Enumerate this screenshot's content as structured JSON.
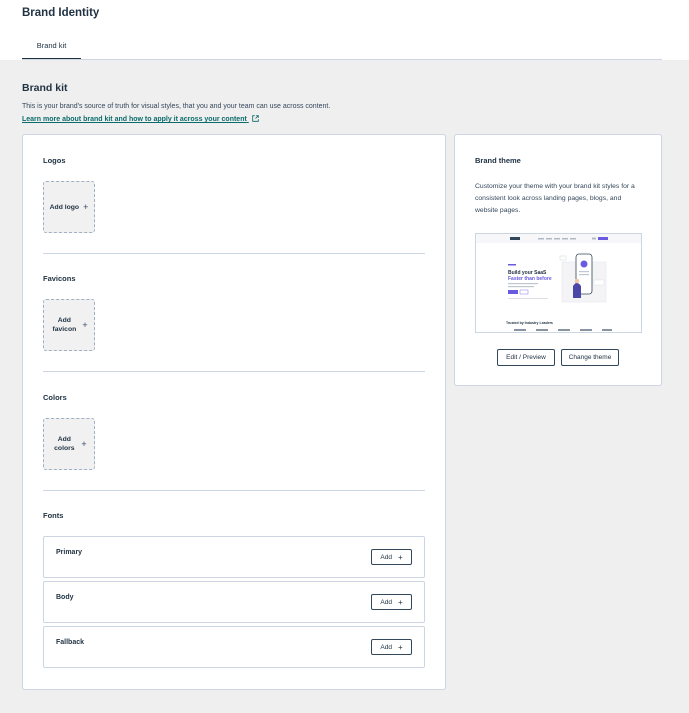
{
  "app": {
    "title": "Brand Identity"
  },
  "tabs": [
    {
      "label": "Brand kit",
      "active": true
    }
  ],
  "page": {
    "heading": "Brand kit",
    "description": "This is your brand's source of truth for visual styles, that you and your team can use across content.",
    "learn_link": "Learn more about brand kit and how to apply it across your content"
  },
  "logos": {
    "title": "Logos",
    "add_label": "Add logo"
  },
  "favicons": {
    "title": "Favicons",
    "add_label": "Add favicon"
  },
  "colors": {
    "title": "Colors",
    "add_label": "Add colors"
  },
  "fonts": {
    "title": "Fonts",
    "add_label": "Add",
    "items": [
      {
        "name": "Primary"
      },
      {
        "name": "Body"
      },
      {
        "name": "Fallback"
      }
    ]
  },
  "theme": {
    "title": "Brand theme",
    "description": "Customize your theme with your brand kit styles for a consistent look across landing pages, blogs, and website pages.",
    "preview": {
      "headline_line1": "Build your SaaS",
      "headline_line2": "Faster than before",
      "footer_text": "Trusted by Industry Leaders"
    },
    "edit_label": "Edit / Preview",
    "change_label": "Change theme"
  },
  "colors_palette": {
    "accent": "#6a5ae0",
    "link": "#0b6b6b",
    "text": "#213343",
    "border": "#cbd6e2"
  }
}
